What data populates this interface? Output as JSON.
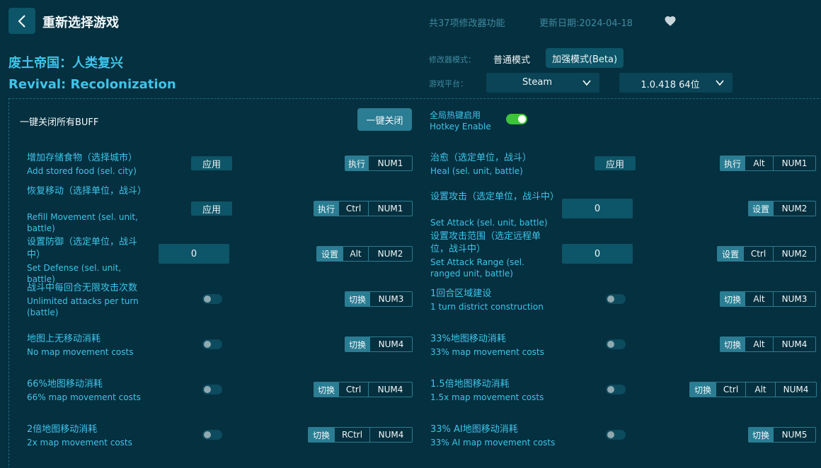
{
  "header": {
    "title": "重新选择游戏",
    "feature_count": "共37项修改器功能",
    "update_date": "更新日期:2024-04-18",
    "back_icon": "chevron-left-icon",
    "favorite_icon": "heart-icon"
  },
  "game": {
    "name_cn": "废土帝国：人类复兴",
    "name_en": "Revival: Recolonization"
  },
  "mode": {
    "label": "修改器模式：",
    "normal": "普通模式",
    "beta": "加强模式(Beta)"
  },
  "platform": {
    "label": "游戏平台：",
    "selected": "Steam",
    "version": "1.0.418 64位"
  },
  "panel": {
    "buff_off_label": "一键关闭所有BUFF",
    "buff_off_button": "一键关闭",
    "hotkey_enable_cn": "全局热键启用",
    "hotkey_enable_en": "Hotkey Enable",
    "hotkey_enabled": true
  },
  "features": [
    {
      "cn": "增加存储食物（选择城市）",
      "en": "Add stored food (sel. city)",
      "control": "应用",
      "action": "执行",
      "keys": [
        "NUM1"
      ]
    },
    {
      "cn": "治愈（选定单位，战斗）",
      "en": "Heal (sel. unit, battle)",
      "control": "应用",
      "action": "执行",
      "keys": [
        "Alt",
        "NUM1"
      ]
    },
    {
      "cn": "恢复移动（选择单位，战斗）",
      "en": "Refill Movement (sel. unit, battle)",
      "control": "应用",
      "action": "执行",
      "keys": [
        "Ctrl",
        "NUM1"
      ]
    },
    {
      "cn": "设置攻击（选定单位，战斗中）",
      "en": "Set Attack (sel. unit, battle)",
      "value": "0",
      "action": "设置",
      "keys": [
        "NUM2"
      ]
    },
    {
      "cn": "设置防御（选定单位，战斗中）",
      "en": "Set Defense (sel. unit, battle)",
      "value": "0",
      "action": "设置",
      "keys": [
        "Alt",
        "NUM2"
      ]
    },
    {
      "cn": "设置攻击范围（选定远程单位，战斗中）",
      "en": "Set Attack Range (sel. ranged unit, battle)",
      "value": "0",
      "action": "设置",
      "keys": [
        "Ctrl",
        "NUM2"
      ]
    },
    {
      "cn": "战斗中每回合无限攻击次数",
      "en": "Unlimited attacks per turn (battle)",
      "toggle": false,
      "action": "切换",
      "keys": [
        "NUM3"
      ]
    },
    {
      "cn": "1回合区域建设",
      "en": "1 turn district construction",
      "toggle": false,
      "action": "切换",
      "keys": [
        "Alt",
        "NUM3"
      ]
    },
    {
      "cn": "地图上无移动消耗",
      "en": "No map movement costs",
      "toggle": false,
      "action": "切换",
      "keys": [
        "NUM4"
      ]
    },
    {
      "cn": "33%地图移动消耗",
      "en": "33% map movement costs",
      "toggle": false,
      "action": "切换",
      "keys": [
        "Alt",
        "NUM4"
      ]
    },
    {
      "cn": "66%地图移动消耗",
      "en": "66% map movement costs",
      "toggle": false,
      "action": "切换",
      "keys": [
        "Ctrl",
        "NUM4"
      ]
    },
    {
      "cn": "1.5倍地图移动消耗",
      "en": "1.5x map movement costs",
      "toggle": false,
      "action": "切换",
      "keys": [
        "Ctrl",
        "Alt",
        "NUM4"
      ]
    },
    {
      "cn": "2倍地图移动消耗",
      "en": "2x map movement costs",
      "toggle": false,
      "action": "切换",
      "keys": [
        "RCtrl",
        "NUM4"
      ]
    },
    {
      "cn": "33% AI地图移动消耗",
      "en": "33% AI map movement costs",
      "toggle": false,
      "action": "切换",
      "keys": [
        "NUM5"
      ]
    }
  ]
}
